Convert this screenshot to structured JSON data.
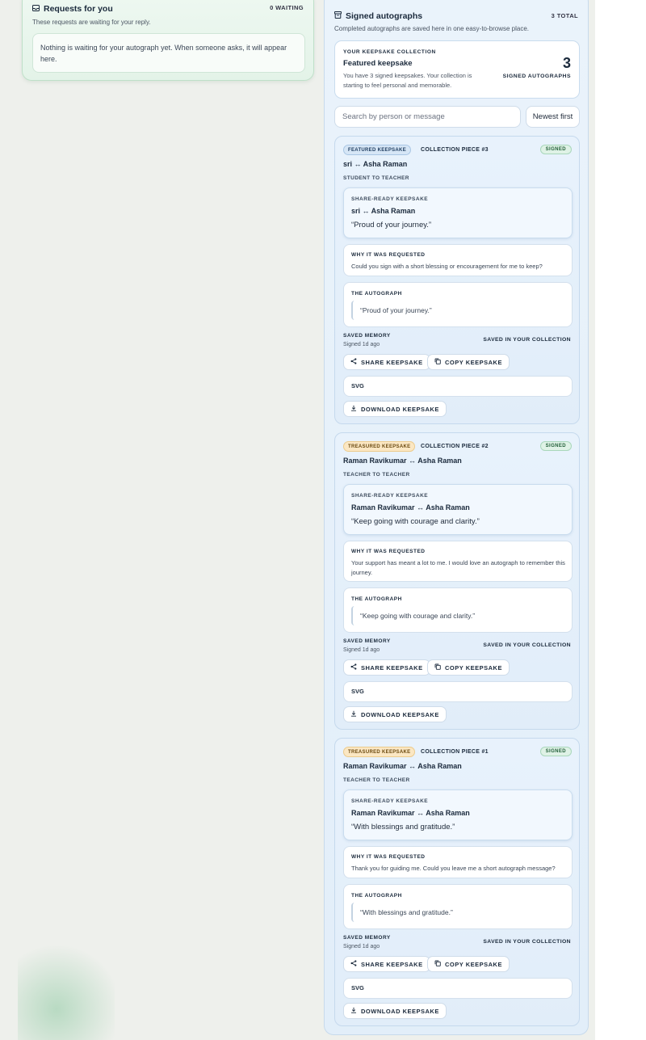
{
  "requests": {
    "title": "Requests for you",
    "count": "0 WAITING",
    "subtitle": "These requests are waiting for your reply.",
    "empty_message": "Nothing is waiting for your autograph yet. When someone asks, it will appear here."
  },
  "signed": {
    "title": "Signed autographs",
    "total": "3 TOTAL",
    "subtitle": "Completed autographs are saved here in one easy-to-browse place.",
    "collection": {
      "eyebrow": "YOUR KEEPSAKE COLLECTION",
      "title": "Featured keepsake",
      "description": "You have 3 signed keepsakes. Your collection is starting to feel personal and memorable.",
      "count": "3",
      "count_label": "SIGNED AUTOGRAPHS"
    },
    "search_placeholder": "Search by person or message",
    "sort_label": "Newest first",
    "labels": {
      "share_ready": "SHARE-READY KEEPSAKE",
      "why": "WHY IT WAS REQUESTED",
      "autograph": "THE AUTOGRAPH",
      "saved_memory": "SAVED MEMORY",
      "saved_collection": "SAVED IN YOUR COLLECTION",
      "share_button": "SHARE KEEPSAKE",
      "copy_button": "COPY KEEPSAKE",
      "format": "SVG",
      "download_button": "DOWNLOAD KEEPSAKE",
      "status": "SIGNED"
    },
    "cards": [
      {
        "tag": "FEATURED KEEPSAKE",
        "piece": "COLLECTION PIECE #3",
        "names": "sri ↔ Asha Raman",
        "relationship": "STUDENT TO TEACHER",
        "quote": "“Proud of your journey.”",
        "reason": "Could you sign with a short blessing or encouragement for me to keep?",
        "autograph": "“Proud of your journey.”",
        "signed_time": "Signed 1d ago"
      },
      {
        "tag": "TREASURED KEEPSAKE",
        "piece": "COLLECTION PIECE #2",
        "names": "Raman Ravikumar ↔ Asha Raman",
        "relationship": "TEACHER TO TEACHER",
        "quote": "“Keep going with courage and clarity.”",
        "reason": "Your support has meant a lot to me. I would love an autograph to remember this journey.",
        "autograph": "“Keep going with courage and clarity.”",
        "signed_time": "Signed 1d ago"
      },
      {
        "tag": "TREASURED KEEPSAKE",
        "piece": "COLLECTION PIECE #1",
        "names": "Raman Ravikumar ↔ Asha Raman",
        "relationship": "TEACHER TO TEACHER",
        "quote": "“With blessings and gratitude.”",
        "reason": "Thank you for guiding me. Could you leave me a short autograph message?",
        "autograph": "“With blessings and gratitude.”",
        "signed_time": "Signed 1d ago"
      }
    ]
  }
}
